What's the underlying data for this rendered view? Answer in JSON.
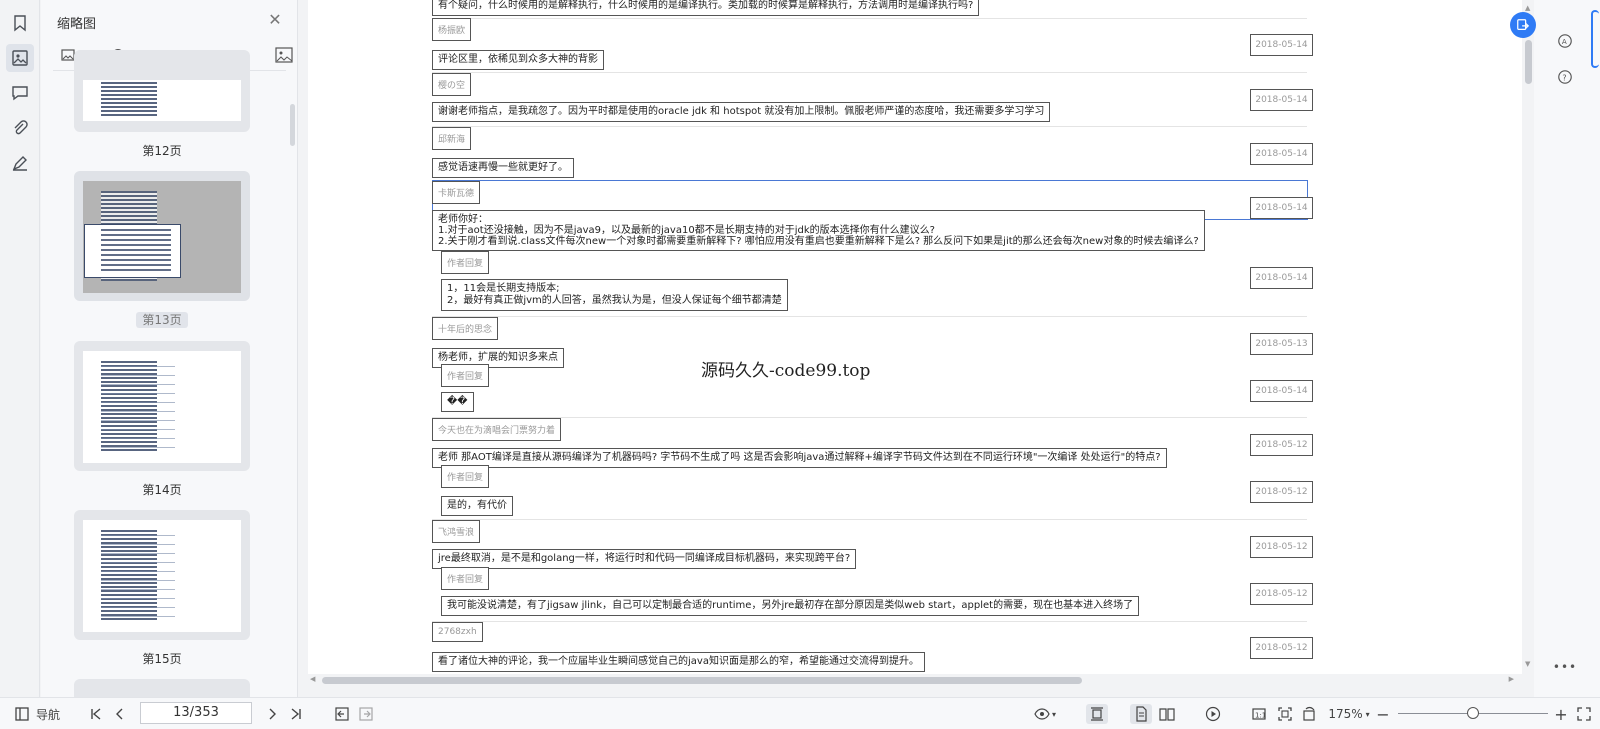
{
  "thumbnails_panel": {
    "title": "缩略图",
    "pages": [
      {
        "label": "第12页"
      },
      {
        "label": "第13页"
      },
      {
        "label": "第14页"
      },
      {
        "label": "第15页"
      }
    ]
  },
  "document": {
    "entries": [
      {
        "type": "comment",
        "text": "有个疑问，什么时候用的是解释执行，什么时候用的是编译执行。类加载的时候算是解释执行，方法调用时是编译执行吗?"
      },
      {
        "type": "author",
        "name": "杨振欧",
        "date": "2018-05-14"
      },
      {
        "type": "comment",
        "text": "评论区里，依稀见到众多大神的背影"
      },
      {
        "type": "author",
        "name": "樱の空",
        "date": "2018-05-14"
      },
      {
        "type": "comment",
        "text": "谢谢老师指点，是我疏忽了。因为平时都是使用的oracle jdk 和 hotspot 就没有加上限制。佩服老师严谨的态度哈，我还需要多学习学习"
      },
      {
        "type": "author",
        "name": "邱新海",
        "date": "2018-05-14"
      },
      {
        "type": "comment",
        "text": "感觉语速再慢一些就更好了。"
      },
      {
        "type": "author",
        "name": "卡斯瓦德",
        "date": "2018-05-14"
      },
      {
        "type": "comment_multi",
        "lines": [
          "老师你好：",
          "1.对于aot还没接触，因为不是java9，以及最新的java10都不是长期支持的对于jdk的版本选择你有什么建议么?",
          "2.关于刚才看到说.class文件每次new一个对象时都需要重新解释下? 哪怕应用没有重启也要重新解释下是么? 那么反问下如果是jit的那么还会每次new对象的时候去编译么?"
        ]
      },
      {
        "type": "reply_label",
        "text": "作者回复",
        "date": "2018-05-14"
      },
      {
        "type": "reply_multi",
        "lines": [
          "1，11会是长期支持版本;",
          "2，最好有真正做jvm的人回答，虽然我认为是，但没人保证每个细节都清楚"
        ]
      },
      {
        "type": "author",
        "name": "十年后的思念",
        "date": "2018-05-13"
      },
      {
        "type": "comment",
        "text": "杨老师，扩展的知识多来点"
      },
      {
        "type": "reply_label",
        "text": "作者回复",
        "date": "2018-05-14"
      },
      {
        "type": "reply",
        "text": "��"
      },
      {
        "type": "author",
        "name": "今天也在为滴唱会门票努力着",
        "date": "2018-05-12"
      },
      {
        "type": "comment",
        "text": "老师 那AOT编译是直接从源码编译为了机器码吗?  字节码不生成了吗 这是否会影响java通过解释+编译字节码文件达到在不同运行环境\"一次编译 处处运行\"的特点?"
      },
      {
        "type": "reply_label",
        "text": "作者回复",
        "date": "2018-05-12"
      },
      {
        "type": "reply",
        "text": "是的，有代价"
      },
      {
        "type": "author",
        "name": "飞鸿雪浪",
        "date": "2018-05-12"
      },
      {
        "type": "comment",
        "text": "jre最终取消，是不是和golang一样，将运行时和代码一同编译成目标机器码，来实现跨平台?"
      },
      {
        "type": "reply_label",
        "text": "作者回复",
        "date": "2018-05-12"
      },
      {
        "type": "reply",
        "text": "我可能没说清楚，有了jigsaw jlink，自己可以定制最合适的runtime，另外jre最初存在部分原因是类似web start，applet的需要，现在也基本进入终场了"
      },
      {
        "type": "author",
        "name": "2768zxh",
        "date": "2018-05-12"
      },
      {
        "type": "comment",
        "text": "看了诸位大神的评论，我一个应届毕业生瞬间感觉自己的java知识面是那么的窄，希望能通过交流得到提升。"
      }
    ],
    "watermark": "源码久久-code99.top"
  },
  "statusbar": {
    "nav_label": "导航",
    "page_value": "13/353",
    "zoom_value": "175%"
  },
  "colors": {
    "accent": "#2f7bf5",
    "selection": "#4a78d4"
  }
}
